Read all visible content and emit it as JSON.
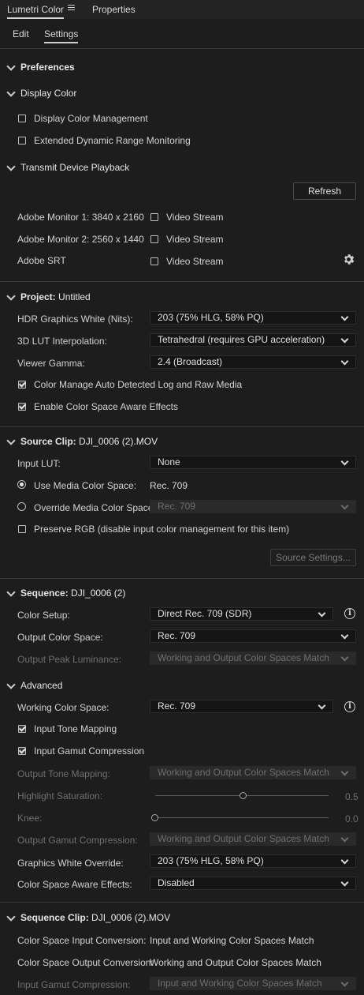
{
  "panel_tabs": {
    "lumetri": "Lumetri Color",
    "properties": "Properties"
  },
  "sub_tabs": {
    "edit": "Edit",
    "settings": "Settings"
  },
  "preferences": {
    "title": "Preferences"
  },
  "display_color": {
    "title": "Display Color",
    "display_color_management": "Display Color Management",
    "edr_monitoring": "Extended Dynamic Range Monitoring"
  },
  "transmit": {
    "title": "Transmit Device Playback",
    "refresh_label": "Refresh",
    "monitors": [
      {
        "name": "Adobe Monitor 1: 3840 x 2160",
        "stream": "Video Stream"
      },
      {
        "name": "Adobe Monitor 2: 2560 x 1440",
        "stream": "Video Stream"
      },
      {
        "name": "Adobe SRT",
        "stream": "Video Stream"
      }
    ]
  },
  "project": {
    "title_bold": "Project:",
    "title_value": "Untitled",
    "hdr_label": "HDR Graphics White (Nits):",
    "hdr_value": "203 (75% HLG, 58% PQ)",
    "lut_label": "3D LUT Interpolation:",
    "lut_value": "Tetrahedral (requires GPU acceleration)",
    "gamma_label": "Viewer Gamma:",
    "gamma_value": "2.4 (Broadcast)",
    "auto_log": "Color Manage Auto Detected Log and Raw Media",
    "aware_effects": "Enable Color Space Aware Effects"
  },
  "source_clip": {
    "title_bold": "Source Clip:",
    "title_value": "DJI_0006 (2).MOV",
    "input_lut_label": "Input LUT:",
    "input_lut_value": "None",
    "use_media_label": "Use Media Color Space:",
    "use_media_value": "Rec. 709",
    "override_label": "Override Media Color Space:",
    "override_value": "Rec. 709",
    "preserve_rgb": "Preserve RGB (disable input color management for this item)",
    "source_settings_label": "Source Settings..."
  },
  "sequence": {
    "title_bold": "Sequence:",
    "title_value": "DJI_0006 (2)",
    "color_setup_label": "Color Setup:",
    "color_setup_value": "Direct Rec. 709 (SDR)",
    "output_space_label": "Output Color Space:",
    "output_space_value": "Rec. 709",
    "peak_label": "Output Peak Luminance:",
    "peak_value": "Working and Output Color Spaces Match"
  },
  "advanced": {
    "title": "Advanced",
    "working_label": "Working Color Space:",
    "working_value": "Rec. 709",
    "input_tone": "Input Tone Mapping",
    "input_gamut": "Input Gamut Compression",
    "out_tone_label": "Output Tone Mapping:",
    "out_tone_value": "Working and Output Color Spaces Match",
    "highlight_label": "Highlight Saturation:",
    "highlight_value": "0.5",
    "knee_label": "Knee:",
    "knee_value": "0.0",
    "out_gamut_label": "Output Gamut Compression:",
    "out_gamut_value": "Working and Output Color Spaces Match",
    "gfx_white_label": "Graphics White Override:",
    "gfx_white_value": "203 (75% HLG, 58% PQ)",
    "aware_label": "Color Space Aware Effects:",
    "aware_value": "Disabled"
  },
  "sequence_clip": {
    "title_bold": "Sequence Clip:",
    "title_value": "DJI_0006 (2).MOV",
    "in_conv_label": "Color Space Input Conversion:",
    "in_conv_value": "Input and Working Color Spaces Match",
    "out_conv_label": "Color Space Output Conversion:",
    "out_conv_value": "Working and Output Color Spaces Match",
    "in_gamut_label": "Input Gamut Compression:",
    "in_gamut_value": "Input and Working Color Spaces Match"
  },
  "icons": {
    "panel_menu": "hamburger-icon",
    "settings": "gear-icon",
    "info": "info-icon",
    "section": "chevron-down-icon"
  },
  "colors": {
    "background": "#1d1d1d",
    "field": "#141414",
    "disabled_field": "#2a2a2a",
    "text": "#d2d2d2",
    "dim_text": "#6f6f6f"
  }
}
